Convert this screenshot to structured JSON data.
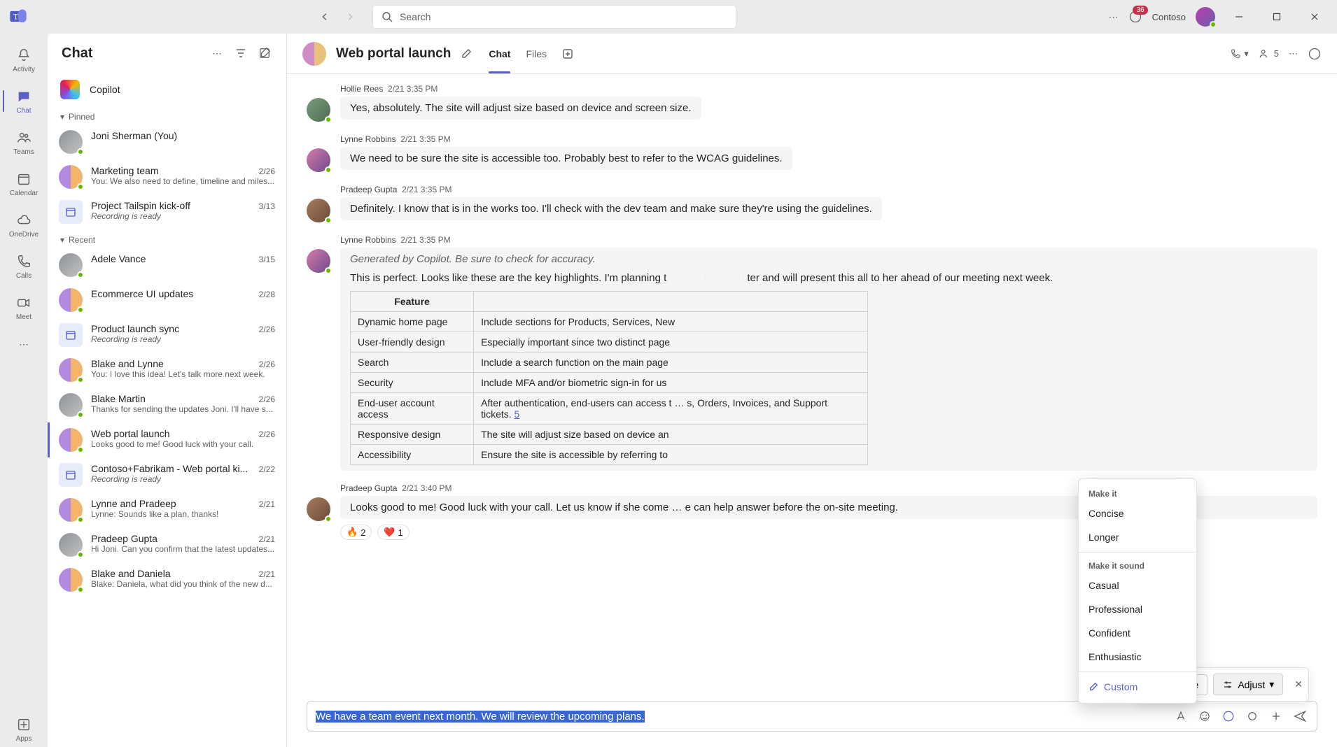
{
  "titlebar": {
    "search_placeholder": "Search",
    "org_name": "Contoso",
    "notif_count": "36"
  },
  "rail": {
    "items": [
      {
        "id": "activity",
        "label": "Activity"
      },
      {
        "id": "chat",
        "label": "Chat"
      },
      {
        "id": "teams",
        "label": "Teams"
      },
      {
        "id": "calendar",
        "label": "Calendar"
      },
      {
        "id": "onedrive",
        "label": "OneDrive"
      },
      {
        "id": "calls",
        "label": "Calls"
      },
      {
        "id": "meet",
        "label": "Meet"
      }
    ],
    "apps_label": "Apps"
  },
  "chatlist": {
    "title": "Chat",
    "copilot_label": "Copilot",
    "section_pinned": "Pinned",
    "section_recent": "Recent",
    "pinned": [
      {
        "name": "Joni Sherman (You)",
        "preview": "",
        "date": ""
      },
      {
        "name": "Marketing team",
        "preview": "You: We also need to define, timeline and miles...",
        "date": "2/26"
      },
      {
        "name": "Project Tailspin kick-off",
        "preview": "Recording is ready",
        "date": "3/13",
        "italic": true,
        "cal": true
      }
    ],
    "recent": [
      {
        "name": "Adele Vance",
        "preview": "",
        "date": "3/15"
      },
      {
        "name": "Ecommerce UI updates",
        "preview": "",
        "date": "2/28"
      },
      {
        "name": "Product launch sync",
        "preview": "Recording is ready",
        "date": "2/26",
        "italic": true,
        "cal": true
      },
      {
        "name": "Blake and Lynne",
        "preview": "You: I love this idea! Let's talk more next week.",
        "date": "2/26"
      },
      {
        "name": "Blake Martin",
        "preview": "Thanks for sending the updates Joni. I'll have s...",
        "date": "2/26"
      },
      {
        "name": "Web portal launch",
        "preview": "Looks good to me! Good luck with your call.",
        "date": "2/26",
        "active": true
      },
      {
        "name": "Contoso+Fabrikam - Web portal ki...",
        "preview": "Recording is ready",
        "date": "2/22",
        "italic": true,
        "cal": true
      },
      {
        "name": "Lynne and Pradeep",
        "preview": "Lynne: Sounds like a plan, thanks!",
        "date": "2/21"
      },
      {
        "name": "Pradeep Gupta",
        "preview": "Hi Joni. Can you confirm that the latest updates...",
        "date": "2/21"
      },
      {
        "name": "Blake and Daniela",
        "preview": "Blake: Daniela, what did you think of the new d...",
        "date": "2/21"
      }
    ]
  },
  "conv": {
    "title": "Web portal launch",
    "tabs": {
      "chat": "Chat",
      "files": "Files"
    },
    "tools": {
      "people_count": "5"
    },
    "messages": [
      {
        "author": "Hollie Rees",
        "time": "2/21 3:35 PM",
        "text": "Yes, absolutely. The site will adjust size based on device and screen size."
      },
      {
        "author": "Lynne Robbins",
        "time": "2/21 3:35 PM",
        "text": "We need to be sure the site is accessible too. Probably best to refer to the WCAG guidelines."
      },
      {
        "author": "Pradeep Gupta",
        "time": "2/21 3:35 PM",
        "text": "Definitely. I know that is in the works too. I'll check with the dev team and make sure they're using the guidelines."
      }
    ],
    "copilot_msg": {
      "author": "Lynne Robbins",
      "time": "2/21 3:35 PM",
      "note": "Generated by Copilot. Be sure to check for accuracy.",
      "intro_a": "This is perfect. Looks like these are the key highlights. I'm planning t",
      "intro_b": "ter and will present this all to her ahead of our meeting next week.",
      "th_feature": "Feature",
      "rows": [
        {
          "f": "Dynamic home page",
          "d": "Include sections for Products, Services, New"
        },
        {
          "f": "User-friendly design",
          "d": "Especially important since two distinct page"
        },
        {
          "f": "Search",
          "d": "Include a search function on the main page"
        },
        {
          "f": "Security",
          "d": "Include MFA and/or biometric sign-in for us"
        },
        {
          "f": "End-user account access",
          "d": "After authentication, end-users can access t … s, Orders, Invoices, and Support tickets. ",
          "link": "5"
        },
        {
          "f": "Responsive design",
          "d": "The site will adjust size based on device an"
        },
        {
          "f": "Accessibility",
          "d": "Ensure the site is accessible by referring to"
        }
      ]
    },
    "closing": {
      "author": "Pradeep Gupta",
      "time": "2/21 3:40 PM",
      "text": "Looks good to me! Good luck with your call. Let us know if she come … e can help answer before the on-site meeting.",
      "react_fire": "2",
      "react_heart": "1"
    }
  },
  "rewrite": {
    "rewrite_label": "Rewrite",
    "adjust_label": "Adjust"
  },
  "adjust_menu": {
    "hdr1": "Make it",
    "concise": "Concise",
    "longer": "Longer",
    "hdr2": "Make it sound",
    "casual": "Casual",
    "professional": "Professional",
    "confident": "Confident",
    "enthusiastic": "Enthusiastic",
    "custom": "Custom"
  },
  "compose": {
    "text": "We have a team event next month. We will review the upcoming plans."
  }
}
